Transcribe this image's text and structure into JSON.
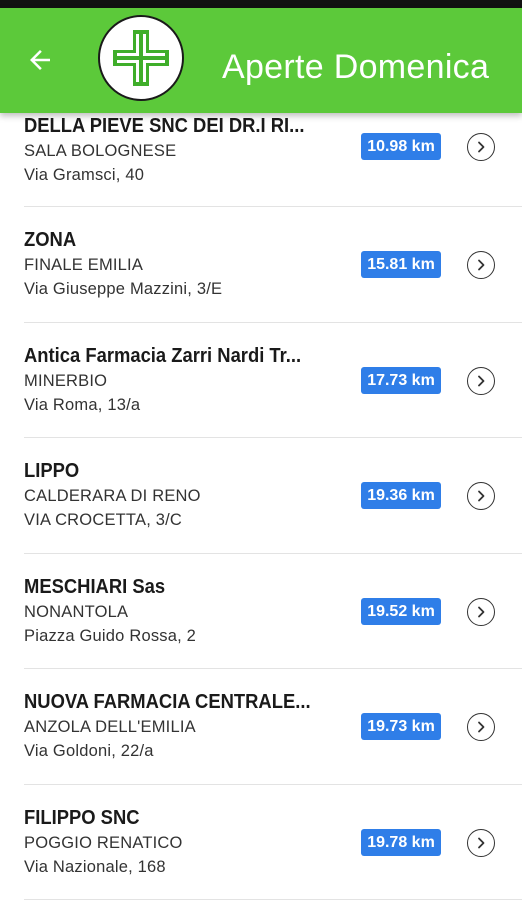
{
  "header": {
    "title": "Aperte Domenica",
    "back_icon": "arrow-left-icon",
    "logo_icon": "pharmacy-cross-icon",
    "color": "#5cc93a"
  },
  "badge_color": "#2f7ee8",
  "pharmacies": [
    {
      "name": "DELLA PIEVE SNC DEI DR.I RI...",
      "city": "SALA BOLOGNESE",
      "address": "Via Gramsci, 40",
      "distance": "10.98 km"
    },
    {
      "name": "ZONA",
      "city": "FINALE EMILIA",
      "address": "Via Giuseppe Mazzini, 3/E",
      "distance": "15.81 km"
    },
    {
      "name": "Antica Farmacia Zarri Nardi Tr...",
      "city": "MINERBIO",
      "address": "Via Roma, 13/a",
      "distance": "17.73 km"
    },
    {
      "name": "LIPPO",
      "city": "CALDERARA DI RENO",
      "address": "VIA CROCETTA, 3/C",
      "distance": "19.36 km"
    },
    {
      "name": "MESCHIARI Sas",
      "city": "NONANTOLA",
      "address": "Piazza Guido Rossa, 2",
      "distance": "19.52 km"
    },
    {
      "name": "NUOVA FARMACIA CENTRALE...",
      "city": "ANZOLA DELL'EMILIA",
      "address": "Via Goldoni, 22/a",
      "distance": "19.73 km"
    },
    {
      "name": "FILIPPO SNC",
      "city": "POGGIO RENATICO",
      "address": "Via Nazionale, 168",
      "distance": "19.78 km"
    }
  ]
}
